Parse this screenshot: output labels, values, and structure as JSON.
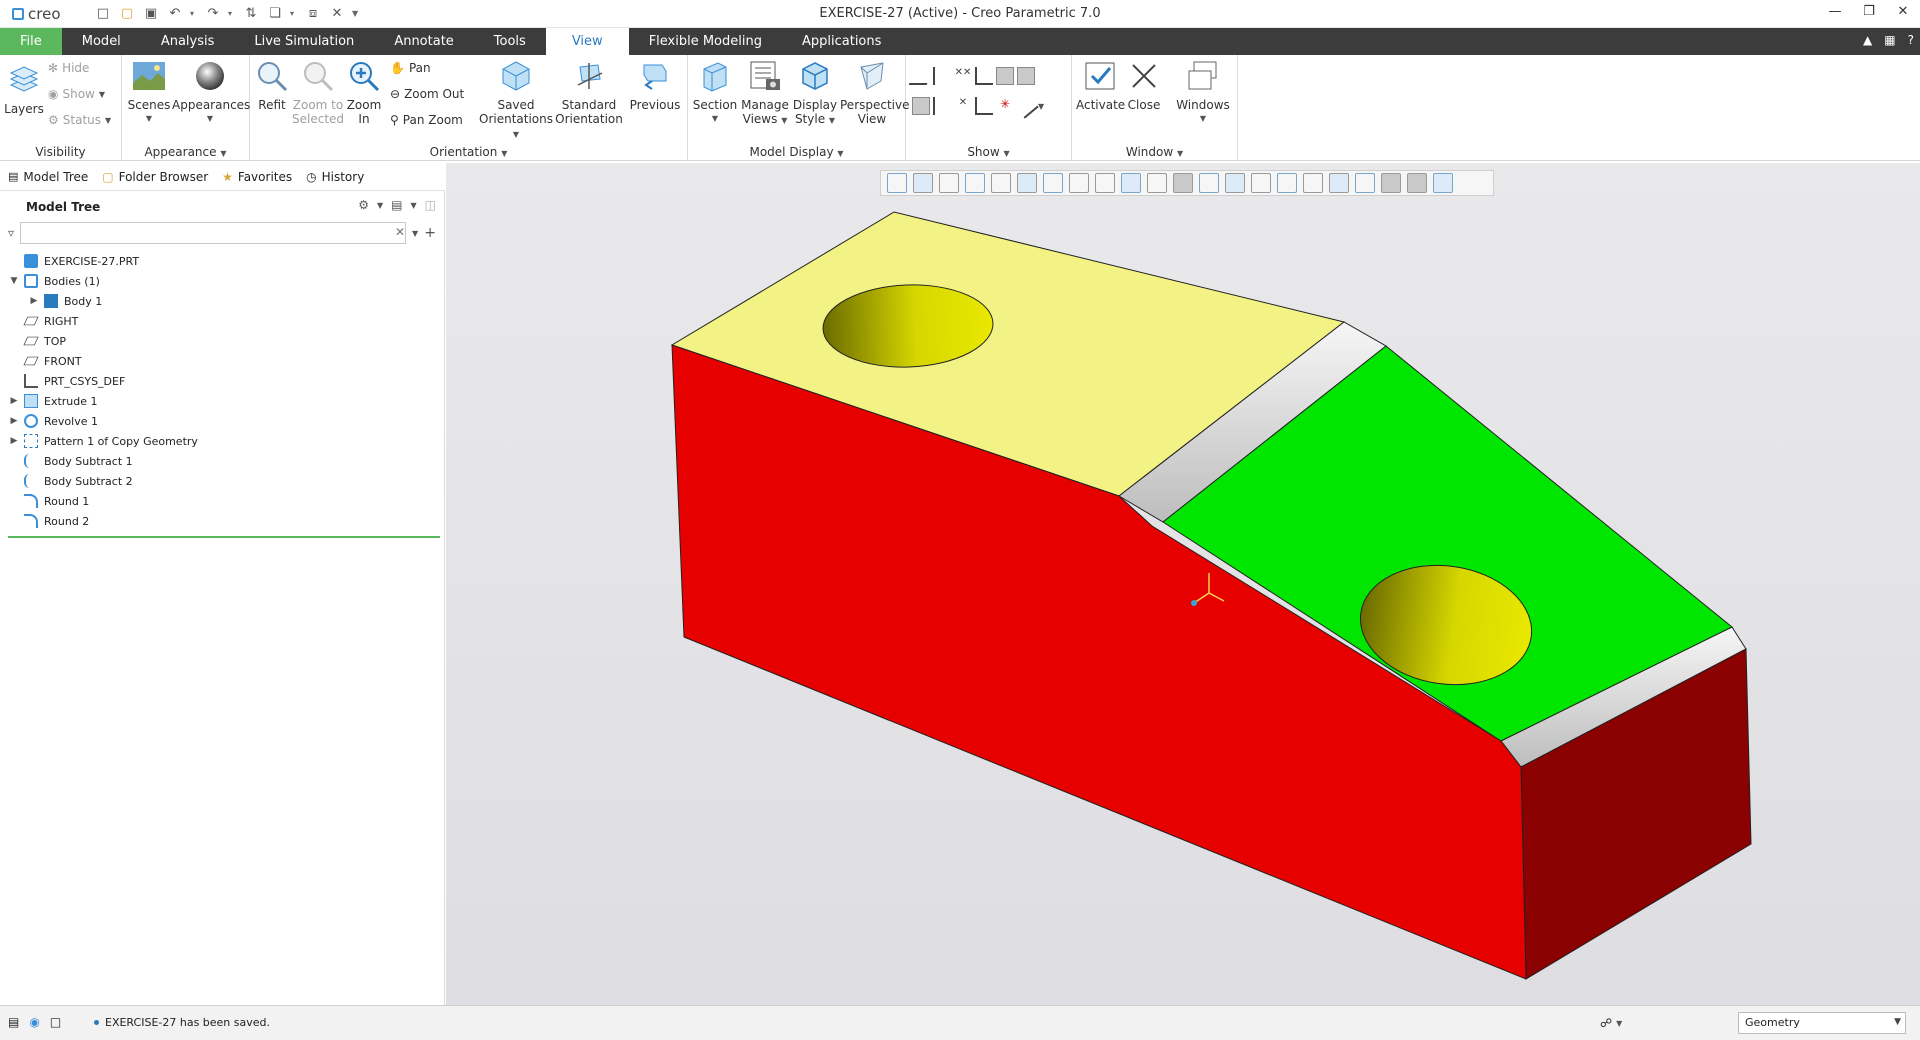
{
  "app": {
    "logo_text": "creo",
    "window_title": "EXERCISE-27 (Active) - Creo Parametric 7.0"
  },
  "tabs": [
    "File",
    "Model",
    "Analysis",
    "Live Simulation",
    "Annotate",
    "Tools",
    "View",
    "Flexible Modeling",
    "Applications"
  ],
  "active_tab": "View",
  "ribbon": {
    "visibility": {
      "label": "Visibility",
      "layers": "Layers",
      "hide": "Hide",
      "show": "Show",
      "status": "Status"
    },
    "appearance": {
      "label": "Appearance",
      "scenes": "Scenes",
      "appearances": "Appearances"
    },
    "orientation": {
      "label": "Orientation",
      "refit": "Refit",
      "zoom_to_selected": "Zoom to Selected",
      "zoom_in": "Zoom In",
      "pan": "Pan",
      "zoom_out": "Zoom Out",
      "pan_zoom": "Pan Zoom",
      "saved_orientations": "Saved Orientations",
      "standard_orientation": "Standard Orientation",
      "previous": "Previous"
    },
    "model_display": {
      "label": "Model Display",
      "section": "Section",
      "manage_views": "Manage Views",
      "display_style": "Display Style",
      "perspective_view": "Perspective View"
    },
    "show": {
      "label": "Show"
    },
    "window": {
      "label": "Window",
      "activate": "Activate",
      "close": "Close",
      "windows": "Windows"
    }
  },
  "left_tabs": [
    "Model Tree",
    "Folder Browser",
    "Favorites",
    "History"
  ],
  "model_tree": {
    "title": "Model Tree",
    "search_value": "",
    "items": [
      {
        "label": "EXERCISE-27.PRT",
        "level": 0,
        "expander": "",
        "icon": "part-icon"
      },
      {
        "label": "Bodies (1)",
        "level": 0,
        "expander": "expanded",
        "icon": "bodies-icon"
      },
      {
        "label": "Body 1",
        "level": 1,
        "expander": "collapsed",
        "icon": "body-icon"
      },
      {
        "label": "RIGHT",
        "level": 0,
        "expander": "",
        "icon": "datum-plane-icon"
      },
      {
        "label": "TOP",
        "level": 0,
        "expander": "",
        "icon": "datum-plane-icon"
      },
      {
        "label": "FRONT",
        "level": 0,
        "expander": "",
        "icon": "datum-plane-icon"
      },
      {
        "label": "PRT_CSYS_DEF",
        "level": 0,
        "expander": "",
        "icon": "csys-icon"
      },
      {
        "label": "Extrude 1",
        "level": 0,
        "expander": "collapsed",
        "icon": "extrude-icon"
      },
      {
        "label": "Revolve 1",
        "level": 0,
        "expander": "collapsed",
        "icon": "revolve-icon"
      },
      {
        "label": "Pattern 1 of Copy Geometry",
        "level": 0,
        "expander": "collapsed",
        "icon": "pattern-icon"
      },
      {
        "label": "Body Subtract 1",
        "level": 0,
        "expander": "",
        "icon": "body-subtract-icon"
      },
      {
        "label": "Body Subtract 2",
        "level": 0,
        "expander": "",
        "icon": "body-subtract-icon"
      },
      {
        "label": "Round 1",
        "level": 0,
        "expander": "",
        "icon": "round-icon"
      },
      {
        "label": "Round 2",
        "level": 0,
        "expander": "",
        "icon": "round-icon"
      }
    ]
  },
  "status": {
    "message": "EXERCISE-27 has been saved.",
    "filter_value": "Geometry"
  },
  "colors": {
    "file_tab": "#5cb85c",
    "active_tab_text": "#2a7abf",
    "face_top": "#f2f285",
    "face_side": "#e60000",
    "face_green": "#00e600",
    "face_end": "#8b0000",
    "round": "#ececec",
    "hole": "#d7d700"
  }
}
